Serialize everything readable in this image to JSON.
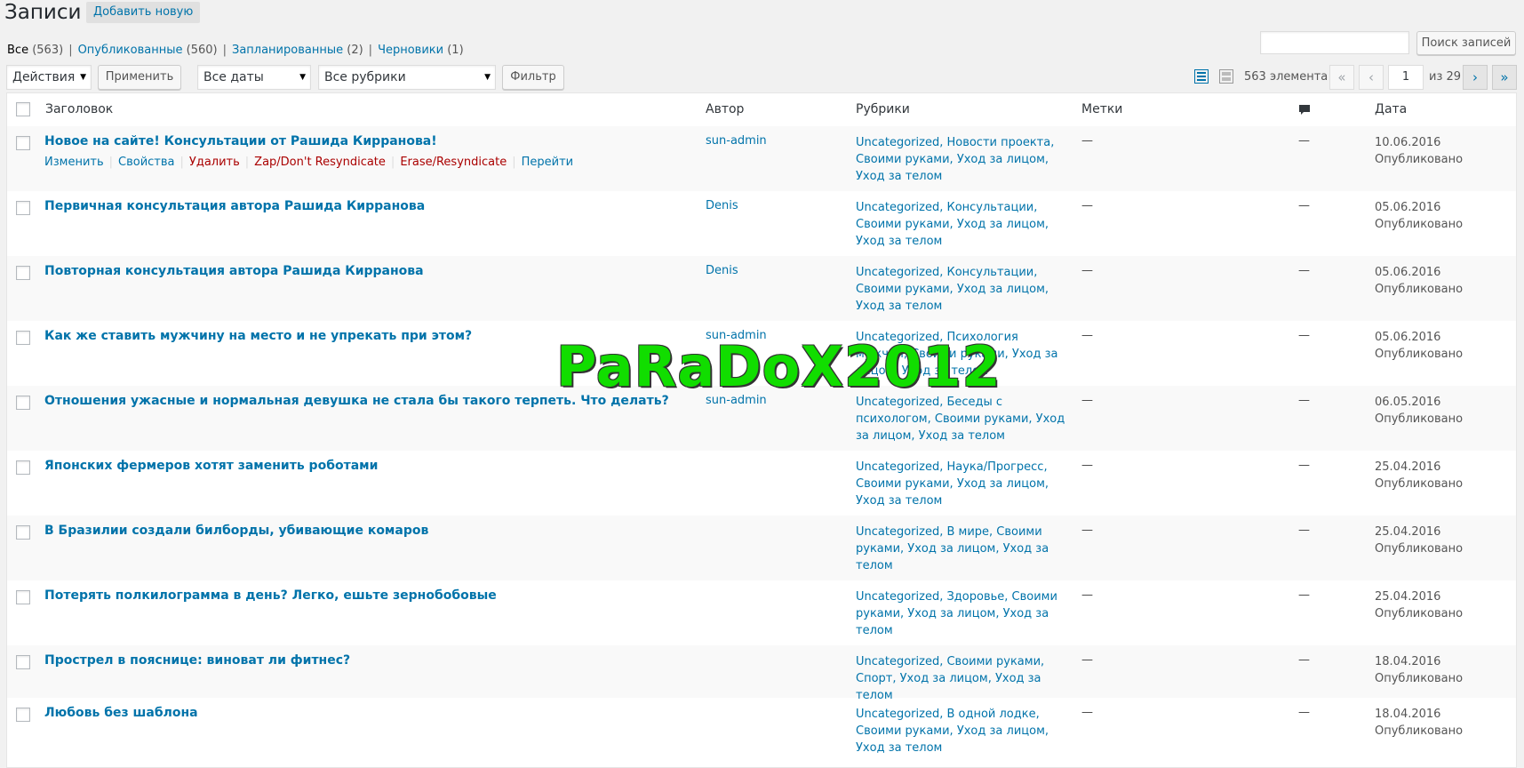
{
  "header": {
    "title": "Записи",
    "add_new": "Добавить новую"
  },
  "filters": [
    {
      "label": "Все",
      "count": "(563)",
      "current": true
    },
    {
      "label": "Опубликованные",
      "count": "(560)"
    },
    {
      "label": "Запланированные",
      "count": "(2)"
    },
    {
      "label": "Черновики",
      "count": "(1)"
    }
  ],
  "search": {
    "value": "",
    "button": "Поиск записей"
  },
  "tablenav": {
    "bulk_action": "Действия",
    "apply": "Применить",
    "dates": "Все даты",
    "categories": "Все рубрики",
    "filter": "Фильтр",
    "items_count": "563 элемента",
    "current_page": "1",
    "total_pages": "из 29",
    "first": "«",
    "prev": "‹",
    "next": "›",
    "last": "»"
  },
  "columns": {
    "title": "Заголовок",
    "author": "Автор",
    "categories": "Рубрики",
    "tags": "Метки",
    "date": "Дата"
  },
  "row_actions": {
    "edit": "Изменить",
    "quick_edit": "Свойства",
    "trash": "Удалить",
    "zap": "Zap/Don't Resyndicate",
    "erase": "Erase/Resyndicate",
    "view": "Перейти"
  },
  "posts": [
    {
      "title": "Новое на сайте! Консультации от Рашида Кирранова!",
      "author": "sun-admin",
      "categories": "Uncategorized, Новости проекта, Своими руками, Уход за лицом, Уход за телом",
      "tags": "—",
      "comments": "—",
      "date": "10.06.2016",
      "status": "Опубликовано"
    },
    {
      "title": "Первичная консультация автора Рашида Кирранова",
      "author": "Denis",
      "categories": "Uncategorized, Консультации, Своими руками, Уход за лицом, Уход за телом",
      "tags": "—",
      "comments": "—",
      "date": "05.06.2016",
      "status": "Опубликовано"
    },
    {
      "title": "Повторная консультация автора Рашида Кирранова",
      "author": "Denis",
      "categories": "Uncategorized, Консультации, Своими руками, Уход за лицом, Уход за телом",
      "tags": "—",
      "comments": "—",
      "date": "05.06.2016",
      "status": "Опубликовано"
    },
    {
      "title": "Как же ставить мужчину на место и не упрекать при этом?",
      "author": "sun-admin",
      "categories": "Uncategorized, Психология мужчин, Своими руками, Уход за лицом, Уход за телом",
      "tags": "—",
      "comments": "—",
      "date": "05.06.2016",
      "status": "Опубликовано"
    },
    {
      "title": "Отношения ужасные и нормальная девушка не стала бы такого терпеть. Что делать?",
      "author": "sun-admin",
      "categories": "Uncategorized, Беседы с психологом, Своими руками, Уход за лицом, Уход за телом",
      "tags": "—",
      "comments": "—",
      "date": "06.05.2016",
      "status": "Опубликовано"
    },
    {
      "title": "Японских фермеров хотят заменить роботами",
      "author": "",
      "categories": "Uncategorized, Наука/Прогресс, Своими руками, Уход за лицом, Уход за телом",
      "tags": "—",
      "comments": "—",
      "date": "25.04.2016",
      "status": "Опубликовано"
    },
    {
      "title": "В Бразилии создали билборды, убивающие комаров",
      "author": "",
      "categories": "Uncategorized, В мире, Своими руками, Уход за лицом, Уход за телом",
      "tags": "—",
      "comments": "—",
      "date": "25.04.2016",
      "status": "Опубликовано"
    },
    {
      "title": "Потерять полкилограмма в день? Легко, ешьте зернобобовые",
      "author": "",
      "categories": "Uncategorized, Здоровье, Своими руками, Уход за лицом, Уход за телом",
      "tags": "—",
      "comments": "—",
      "date": "25.04.2016",
      "status": "Опубликовано"
    },
    {
      "title": "Прострел в пояснице: виноват ли фитнес?",
      "author": "",
      "categories": "Uncategorized, Своими руками, Спорт, Уход за лицом, Уход за телом",
      "tags": "—",
      "comments": "—",
      "date": "18.04.2016",
      "status": "Опубликовано"
    },
    {
      "title": "Любовь без шаблона",
      "author": "",
      "categories": "Uncategorized, В одной лодке, Своими руками, Уход за лицом, Уход за телом",
      "tags": "—",
      "comments": "—",
      "date": "18.04.2016",
      "status": "Опубликовано"
    }
  ],
  "watermark": "PaRaDoX2012",
  "colors": {
    "link": "#0073aa",
    "danger": "#a00",
    "watermark": "#11dd00"
  }
}
